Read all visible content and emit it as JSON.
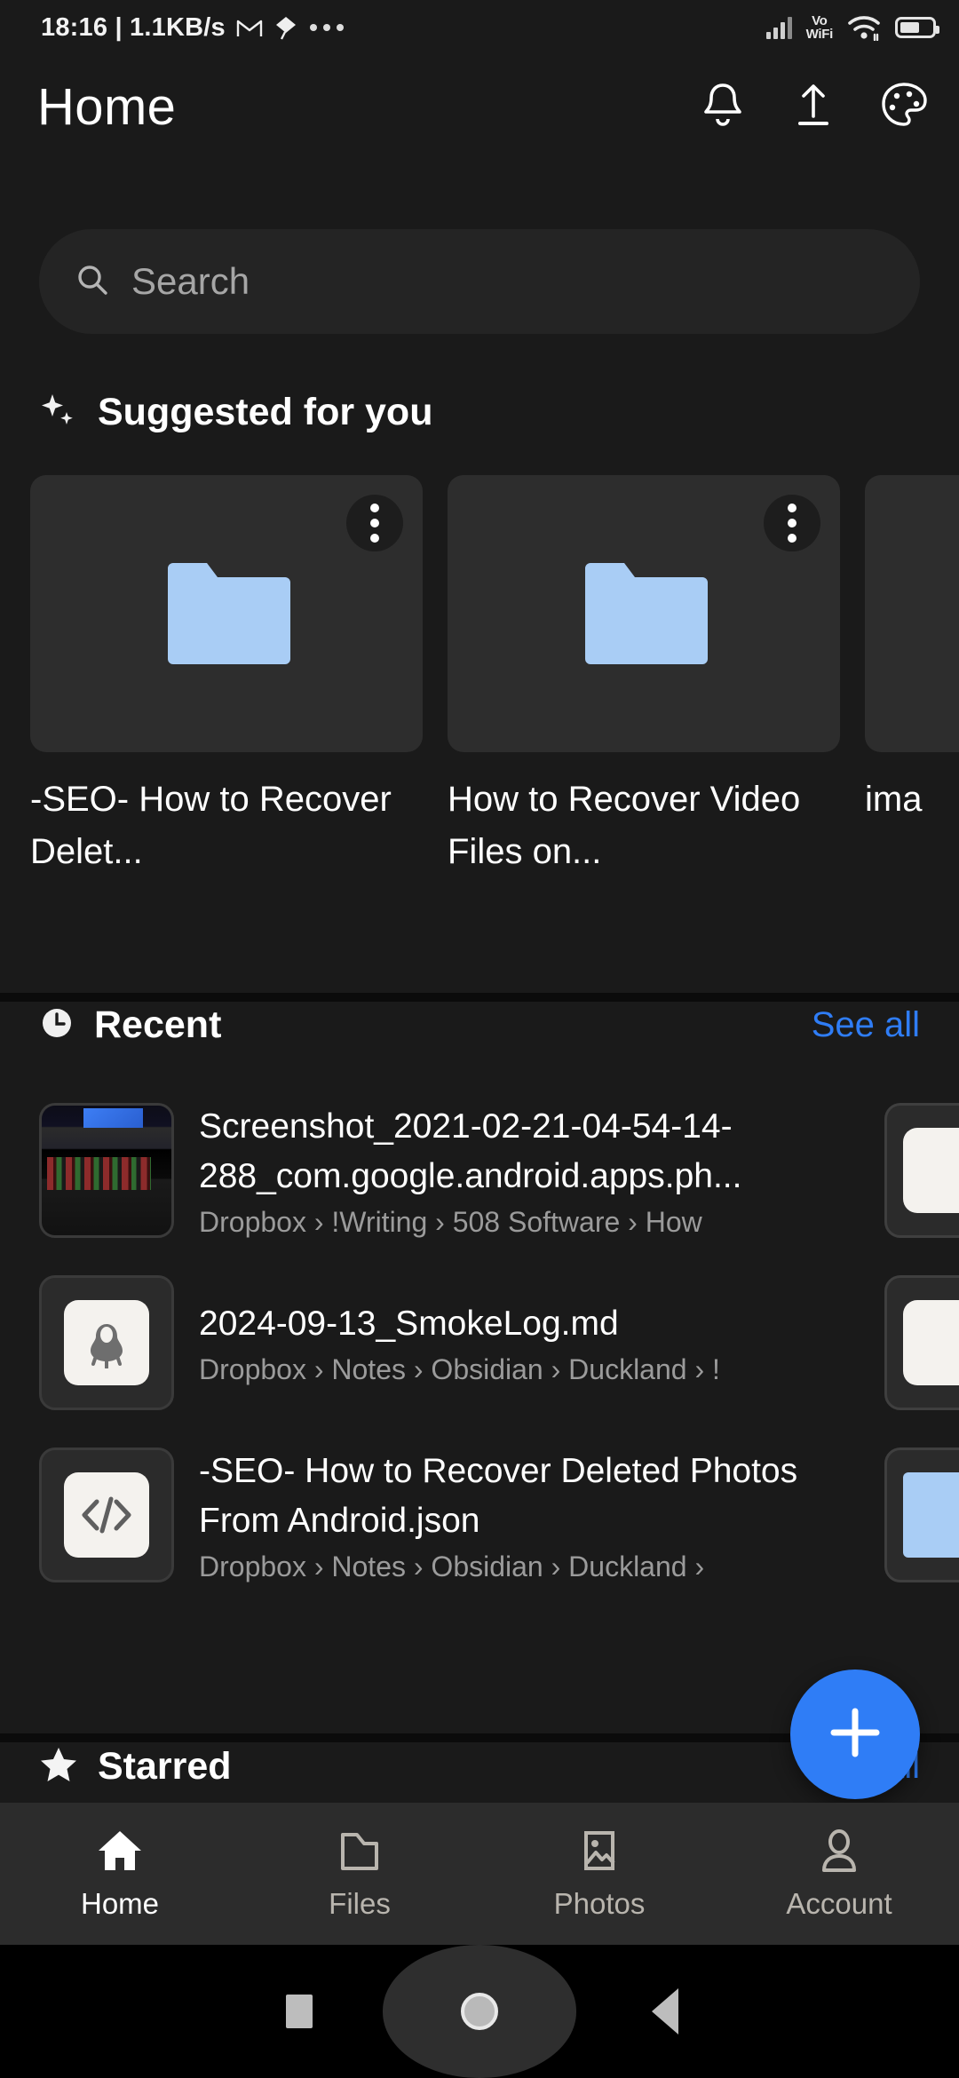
{
  "statusbar": {
    "time": "18:16",
    "separator": "|",
    "network_speed": "1.1KB/s",
    "gmail_icon": "gmail-icon",
    "kite_icon": "kite-icon",
    "overflow_icon": "more-dots-icon",
    "signal_icon": "cellular-signal-icon",
    "vowifi_line1": "Vo",
    "vowifi_line2": "WiFi",
    "wifi_icon": "wifi-icon",
    "battery_icon": "battery-icon"
  },
  "appbar": {
    "title": "Home",
    "actions": [
      {
        "name": "notifications-button",
        "icon": "bell-icon"
      },
      {
        "name": "upload-button",
        "icon": "upload-icon"
      },
      {
        "name": "theme-button",
        "icon": "palette-icon"
      }
    ]
  },
  "search": {
    "placeholder": "Search",
    "icon": "search-icon"
  },
  "suggested": {
    "title": "Suggested for you",
    "icon": "sparkle-icon",
    "cards": [
      {
        "name": "-SEO- How to Recover Delet...",
        "thumb": "folder-icon",
        "menu": "more-options-icon"
      },
      {
        "name": "How to Recover Video Files on...",
        "thumb": "folder-icon",
        "menu": "more-options-icon"
      },
      {
        "name": "ima",
        "thumb": "folder-icon",
        "menu": "more-options-icon"
      }
    ]
  },
  "recent": {
    "title": "Recent",
    "icon": "clock-icon",
    "see_all": "See all",
    "items": [
      {
        "name": "Screenshot_2021-02-21-04-54-14-288_com.google.android.apps.ph...",
        "path": "Dropbox › !Writing › 508 Software › How",
        "thumb": "photo-thumbnail",
        "menu": "more-options-icon"
      },
      {
        "name": "2024-09-13_SmokeLog.md",
        "path": "Dropbox › Notes › Obsidian › Duckland › !",
        "thumb": "obsidian-icon",
        "menu": "more-options-icon"
      },
      {
        "name": "-SEO- How to Recover Deleted Photos From Android.json",
        "path": "Dropbox › Notes › Obsidian › Duckland ›",
        "thumb": "code-file-icon",
        "menu": "more-options-icon"
      }
    ]
  },
  "starred": {
    "title": "Starred",
    "icon": "star-icon",
    "see_all": "See all"
  },
  "fab": {
    "label": "+",
    "icon": "plus-icon",
    "color": "#2f7df6"
  },
  "bottom_nav": {
    "items": [
      {
        "label": "Home",
        "icon": "home-icon",
        "active": true
      },
      {
        "label": "Files",
        "icon": "folder-icon",
        "active": false
      },
      {
        "label": "Photos",
        "icon": "image-icon",
        "active": false
      },
      {
        "label": "Account",
        "icon": "person-icon",
        "active": false
      }
    ]
  },
  "system_nav": {
    "recents": "square-recents-icon",
    "home": "circle-home-icon",
    "back": "triangle-back-icon"
  },
  "colors": {
    "background": "#1a1a1a",
    "surface": "#2d2d2d",
    "accent": "#2f7df6",
    "folder": "#a9cdf5",
    "muted_text": "#9b9b9b"
  }
}
